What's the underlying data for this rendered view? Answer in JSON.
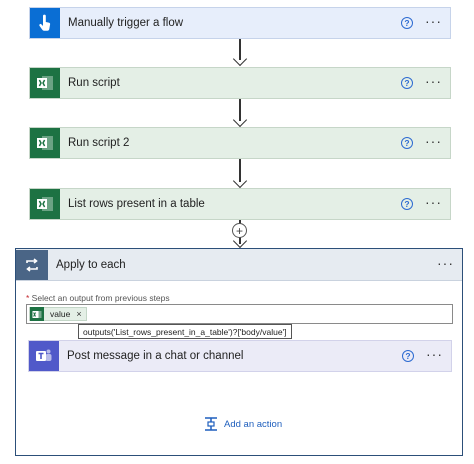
{
  "flow": {
    "steps": [
      {
        "title": "Manually trigger a flow",
        "icon": "hand-tap-icon"
      },
      {
        "title": "Run script",
        "icon": "excel-icon"
      },
      {
        "title": "Run script 2",
        "icon": "excel-icon"
      },
      {
        "title": "List rows present in a table",
        "icon": "excel-icon"
      }
    ],
    "help_glyph": "?",
    "more_glyph": "···",
    "insert_glyph": "+"
  },
  "apply_to_each": {
    "title": "Apply to each",
    "more_glyph": "···",
    "select_label_star": "*",
    "select_label": " Select an output from previous steps",
    "token": {
      "text": "value",
      "close": "×"
    },
    "tooltip": "outputs('List_rows_present_in_a_table')?['body/value']",
    "inner_step": {
      "title": "Post message in a chat or channel",
      "icon": "teams-icon"
    },
    "add_action": "Add an action"
  },
  "colors": {
    "trigger_blue": "#0a6ed4",
    "excel_green": "#1d7243",
    "teams_purple": "#5059c9",
    "scope_border": "#2c4f79",
    "link_blue": "#1f5fbd"
  }
}
